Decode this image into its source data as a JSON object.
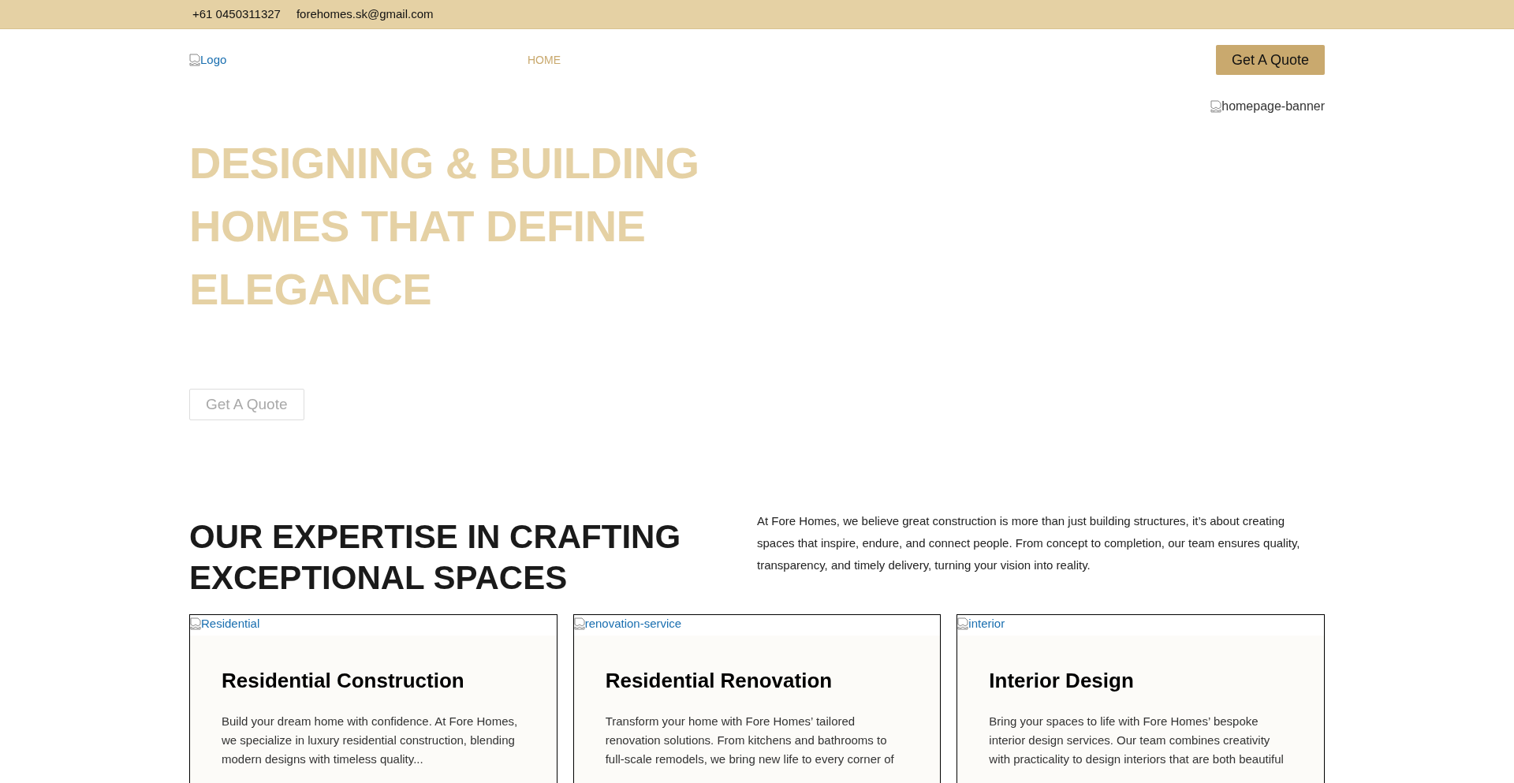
{
  "top_bar": {
    "phone": "+61 0450311327",
    "email": "forehomes.sk@gmail.com"
  },
  "nav": {
    "logo_alt": "Logo",
    "links": [
      {
        "label": "HOME",
        "selected": true
      }
    ],
    "cta": "Get A Quote"
  },
  "hero": {
    "banner_alt": "homepage-banner",
    "heading_lines": [
      "DESIGNING & BUILDING",
      "HOMES THAT DEFINE",
      "ELEGANCE"
    ],
    "cta": "Get A Quote"
  },
  "expertise": {
    "heading_lines": [
      "OUR EXPERTISE IN CRAFTING",
      "EXCEPTIONAL SPACES"
    ],
    "text": "At Fore Homes, we believe great construction is more than just building structures, it’s about creating spaces that inspire, endure, and connect people. From concept to completion, our team ensures quality, transparency, and timely delivery, turning your vision into reality."
  },
  "services": [
    {
      "image_alt": "Residential",
      "title": "Residential Construction",
      "lines": [
        "Build your dream home with confidence. At Fore Homes,",
        "we specialize in luxury residential construction, blending",
        "modern designs with timeless quality..."
      ]
    },
    {
      "image_alt": "renovation-service",
      "title": "Residential Renovation",
      "lines": [
        "Transform your home with Fore Homes’ tailored",
        "renovation solutions. From kitchens and bathrooms to",
        "full-scale remodels, we bring new life to every corner of"
      ]
    },
    {
      "image_alt": "interior",
      "title": "Interior Design",
      "lines": [
        "Bring your spaces to life with Fore Homes’ bespoke",
        "interior design services. Our team combines creativity",
        "with practicality to design interiors that are both beautiful"
      ]
    }
  ]
}
